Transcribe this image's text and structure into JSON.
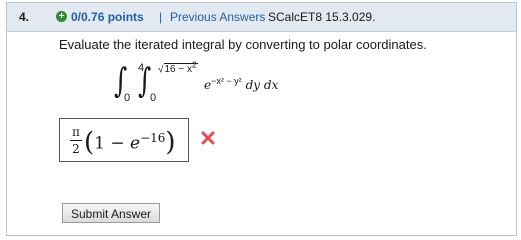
{
  "header": {
    "question_number": "4.",
    "points": "0/0.76 points",
    "separator": "|",
    "previous_answers_label": "Previous Answers",
    "source_id": "SCalcET8 15.3.029."
  },
  "question": {
    "prompt": "Evaluate the iterated integral by converting to polar coordinates.",
    "outer_upper_limit": "4",
    "outer_lower_limit": "0",
    "inner_upper_limit": "16 − x",
    "inner_upper_exponent": "2",
    "inner_lower_limit": "0",
    "integrand_base": "e",
    "integrand_exponent": "−x² − y²",
    "differentials": "dy dx"
  },
  "answer": {
    "coefficient_numerator": "π",
    "coefficient_denominator": "2",
    "open_paren": "(",
    "body": "1 − ",
    "exp_base": "e",
    "exp_power": "−16",
    "close_paren": ")",
    "status_icon": "incorrect-x-icon",
    "status_color": "#e05050"
  },
  "actions": {
    "submit_label": "Submit Answer"
  }
}
